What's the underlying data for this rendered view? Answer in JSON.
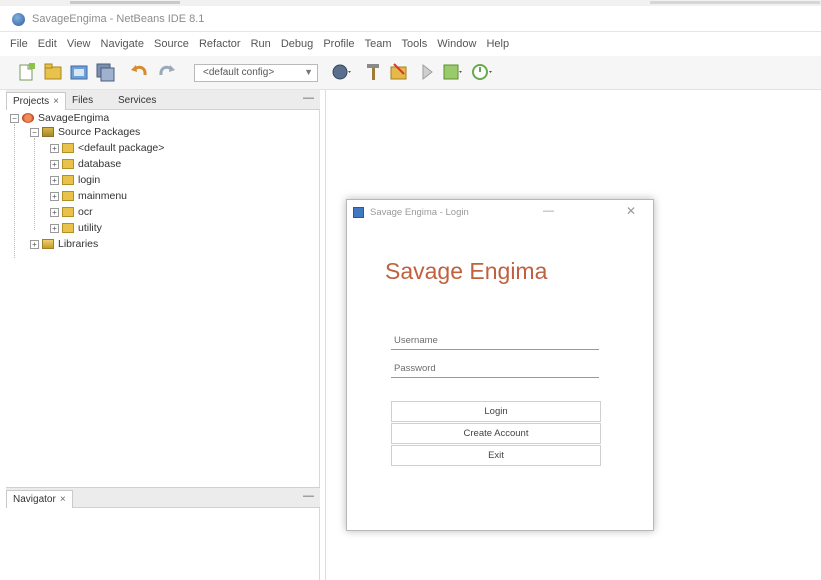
{
  "window": {
    "title": "SavageEngima - NetBeans IDE 8.1"
  },
  "menu": [
    "File",
    "Edit",
    "View",
    "Navigate",
    "Source",
    "Refactor",
    "Run",
    "Debug",
    "Profile",
    "Team",
    "Tools",
    "Window",
    "Help"
  ],
  "toolbar": {
    "config_value": "<default config>"
  },
  "projects_panel": {
    "tabs": [
      "Projects",
      "Files",
      "Services"
    ],
    "tree": [
      {
        "label": "SavageEngima",
        "icon": "project-icon"
      },
      {
        "label": "Source Packages",
        "icon": "source-packages-icon"
      },
      {
        "label": "<default package>",
        "icon": "package-icon"
      },
      {
        "label": "database",
        "icon": "package-icon"
      },
      {
        "label": "login",
        "icon": "package-icon"
      },
      {
        "label": "mainmenu",
        "icon": "package-icon"
      },
      {
        "label": "ocr",
        "icon": "package-icon"
      },
      {
        "label": "utility",
        "icon": "package-icon"
      },
      {
        "label": "Libraries",
        "icon": "libraries-icon"
      }
    ]
  },
  "navigator_panel": {
    "tab": "Navigator"
  },
  "dialog": {
    "title": "Savage Engima - Login",
    "brand": "Savage Engima",
    "username_placeholder": "Username",
    "password_placeholder": "Password",
    "buttons": {
      "login": "Login",
      "create_account": "Create Account",
      "exit": "Exit"
    },
    "accent_color": "#c0603f"
  },
  "colors": {
    "accent": "#c0603f",
    "toolbar_bg": "#f6f6f6",
    "panel_tab_bg": "#ececec"
  }
}
